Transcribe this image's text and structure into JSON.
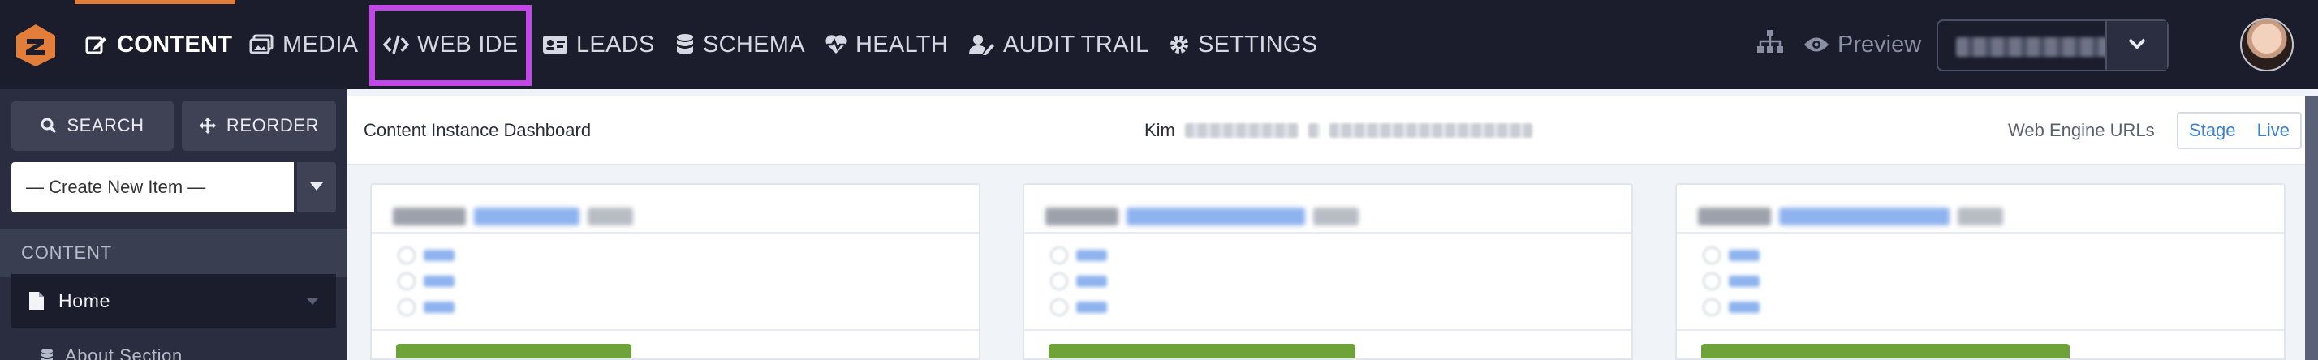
{
  "nav": {
    "items": [
      {
        "label": "CONTENT",
        "icon": "edit-icon"
      },
      {
        "label": "MEDIA",
        "icon": "images-icon"
      },
      {
        "label": "WEB IDE",
        "icon": "code-icon"
      },
      {
        "label": "LEADS",
        "icon": "id-card-icon"
      },
      {
        "label": "SCHEMA",
        "icon": "database-icon"
      },
      {
        "label": "HEALTH",
        "icon": "heartbeat-icon"
      },
      {
        "label": "AUDIT TRAIL",
        "icon": "user-edit-icon"
      },
      {
        "label": "SETTINGS",
        "icon": "gear-icon"
      }
    ],
    "active": "CONTENT",
    "highlighted": "WEB IDE",
    "preview_label": "Preview",
    "colors": {
      "bar": "#1b1d2c",
      "accent": "#e27e3a",
      "highlight": "#c246e8"
    }
  },
  "sidebar": {
    "search_label": "SEARCH",
    "reorder_label": "REORDER",
    "create_item_label": "— Create New Item —",
    "section_label": "CONTENT",
    "tree": {
      "home_label": "Home",
      "child_label": "About Section"
    }
  },
  "main": {
    "title": "Content Instance Dashboard",
    "user_first_name": "Kim",
    "web_engine_label": "Web Engine URLs",
    "stage_label": "Stage",
    "live_label": "Live"
  }
}
